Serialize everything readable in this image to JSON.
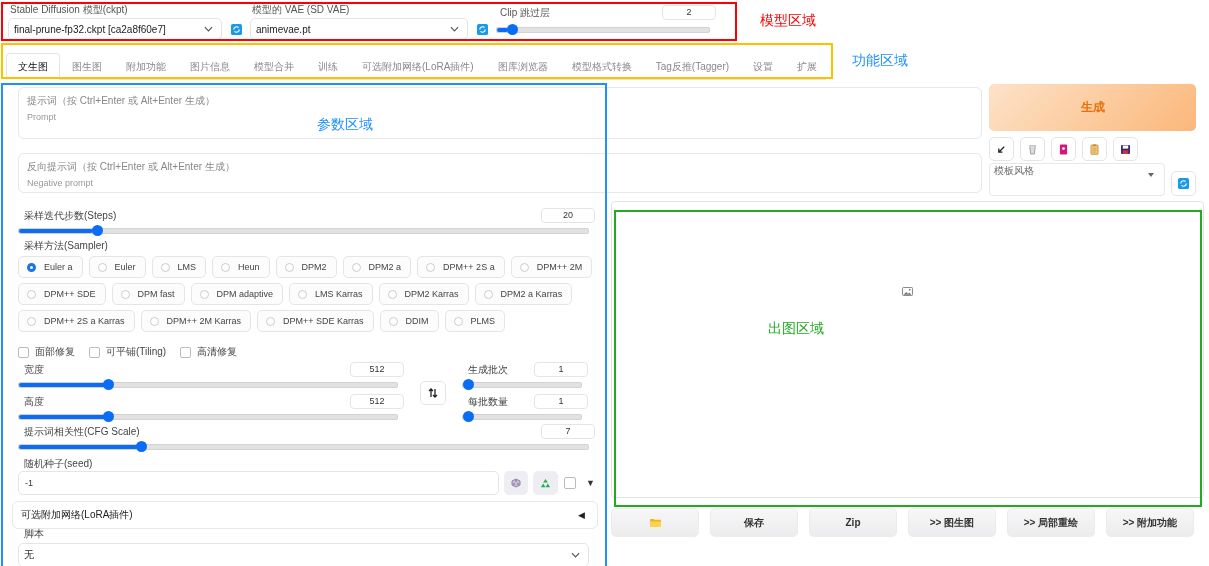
{
  "model_bar": {
    "checkpoint": {
      "label": "Stable Diffusion 模型(ckpt)",
      "value": "final-prune-fp32.ckpt [ca2a8f60e7]"
    },
    "vae": {
      "label": "模型的 VAE (SD VAE)",
      "value": "animevae.pt"
    },
    "clip_skip": {
      "label": "Clip 跳过层",
      "value": "2",
      "level": 0.05
    }
  },
  "tabs": [
    {
      "label": "文生图",
      "selected": true
    },
    {
      "label": "图生图",
      "selected": false
    },
    {
      "label": "附加功能",
      "selected": false
    },
    {
      "label": "图片信息",
      "selected": false
    },
    {
      "label": "模型合并",
      "selected": false
    },
    {
      "label": "训练",
      "selected": false
    },
    {
      "label": "可选附加网络(LoRA插件)",
      "selected": false
    },
    {
      "label": "图库浏览器",
      "selected": false
    },
    {
      "label": "模型格式转换",
      "selected": false
    },
    {
      "label": "Tag反推(Tagger)",
      "selected": false
    },
    {
      "label": "设置",
      "selected": false
    },
    {
      "label": "扩展",
      "selected": false
    }
  ],
  "prompt": {
    "label": "提示词（按 Ctrl+Enter 或 Alt+Enter 生成）",
    "placeholder": "Prompt"
  },
  "negative_prompt": {
    "label": "反向提示词（按 Ctrl+Enter 或 Alt+Enter 生成）",
    "placeholder": "Negative prompt"
  },
  "generate_button": "生成",
  "style": {
    "label": "模板风格"
  },
  "steps": {
    "label": "采样迭代步数(Steps)",
    "value": "20",
    "level": 0.13
  },
  "sampler": {
    "label": "采样方法(Sampler)",
    "options": [
      {
        "label": "Euler a",
        "selected": true
      },
      {
        "label": "Euler",
        "selected": false
      },
      {
        "label": "LMS",
        "selected": false
      },
      {
        "label": "Heun",
        "selected": false
      },
      {
        "label": "DPM2",
        "selected": false
      },
      {
        "label": "DPM2 a",
        "selected": false
      },
      {
        "label": "DPM++ 2S a",
        "selected": false
      },
      {
        "label": "DPM++ 2M",
        "selected": false
      },
      {
        "label": "DPM++ SDE",
        "selected": false
      },
      {
        "label": "DPM fast",
        "selected": false
      },
      {
        "label": "DPM adaptive",
        "selected": false
      },
      {
        "label": "LMS Karras",
        "selected": false
      },
      {
        "label": "DPM2 Karras",
        "selected": false
      },
      {
        "label": "DPM2 a Karras",
        "selected": false
      },
      {
        "label": "DPM++ 2S a Karras",
        "selected": false
      },
      {
        "label": "DPM++ 2M Karras",
        "selected": false
      },
      {
        "label": "DPM++ SDE Karras",
        "selected": false
      },
      {
        "label": "DDIM",
        "selected": false
      },
      {
        "label": "PLMS",
        "selected": false
      }
    ]
  },
  "options": [
    {
      "label": "面部修复",
      "checked": false
    },
    {
      "label": "可平铺(Tiling)",
      "checked": false
    },
    {
      "label": "高清修复",
      "checked": false
    }
  ],
  "width": {
    "label": "宽度",
    "value": "512",
    "level": 0.23
  },
  "height": {
    "label": "高度",
    "value": "512",
    "level": 0.23
  },
  "batch_count": {
    "label": "生成批次",
    "value": "1",
    "level": 0
  },
  "batch_size": {
    "label": "每批数量",
    "value": "1",
    "level": 0
  },
  "cfg_scale": {
    "label": "提示词相关性(CFG Scale)",
    "value": "7",
    "level": 0.21
  },
  "seed": {
    "label": "随机种子(seed)",
    "value": "-1",
    "extra_checked": false,
    "toggle": "▼"
  },
  "lora_accordion": {
    "title": "可选附加网络(LoRA插件)",
    "toggle": "◀"
  },
  "script": {
    "label": "脚本",
    "value": "无"
  },
  "output_buttons": [
    {
      "kind": "folder"
    },
    {
      "kind": "text",
      "label": "保存"
    },
    {
      "kind": "text",
      "label": "Zip"
    },
    {
      "kind": "text",
      "label": ">> 图生图"
    },
    {
      "kind": "text",
      "label": ">> 局部重绘"
    },
    {
      "kind": "text",
      "label": ">> 附加功能"
    }
  ],
  "annotations": [
    {
      "color": "#ff0000",
      "label": {
        "text": "模型区域",
        "color": "#ff0000"
      }
    },
    {
      "color": "#ffc000",
      "label": {
        "text": "功能区域",
        "color": "#1e90ff"
      }
    },
    {
      "color": "#1e90ff",
      "label": {
        "text": "参数区域",
        "color": "#1e90ff"
      }
    },
    {
      "color": "#22aa22",
      "label": {
        "text": "出图区域",
        "color": "#22aa22"
      }
    }
  ]
}
